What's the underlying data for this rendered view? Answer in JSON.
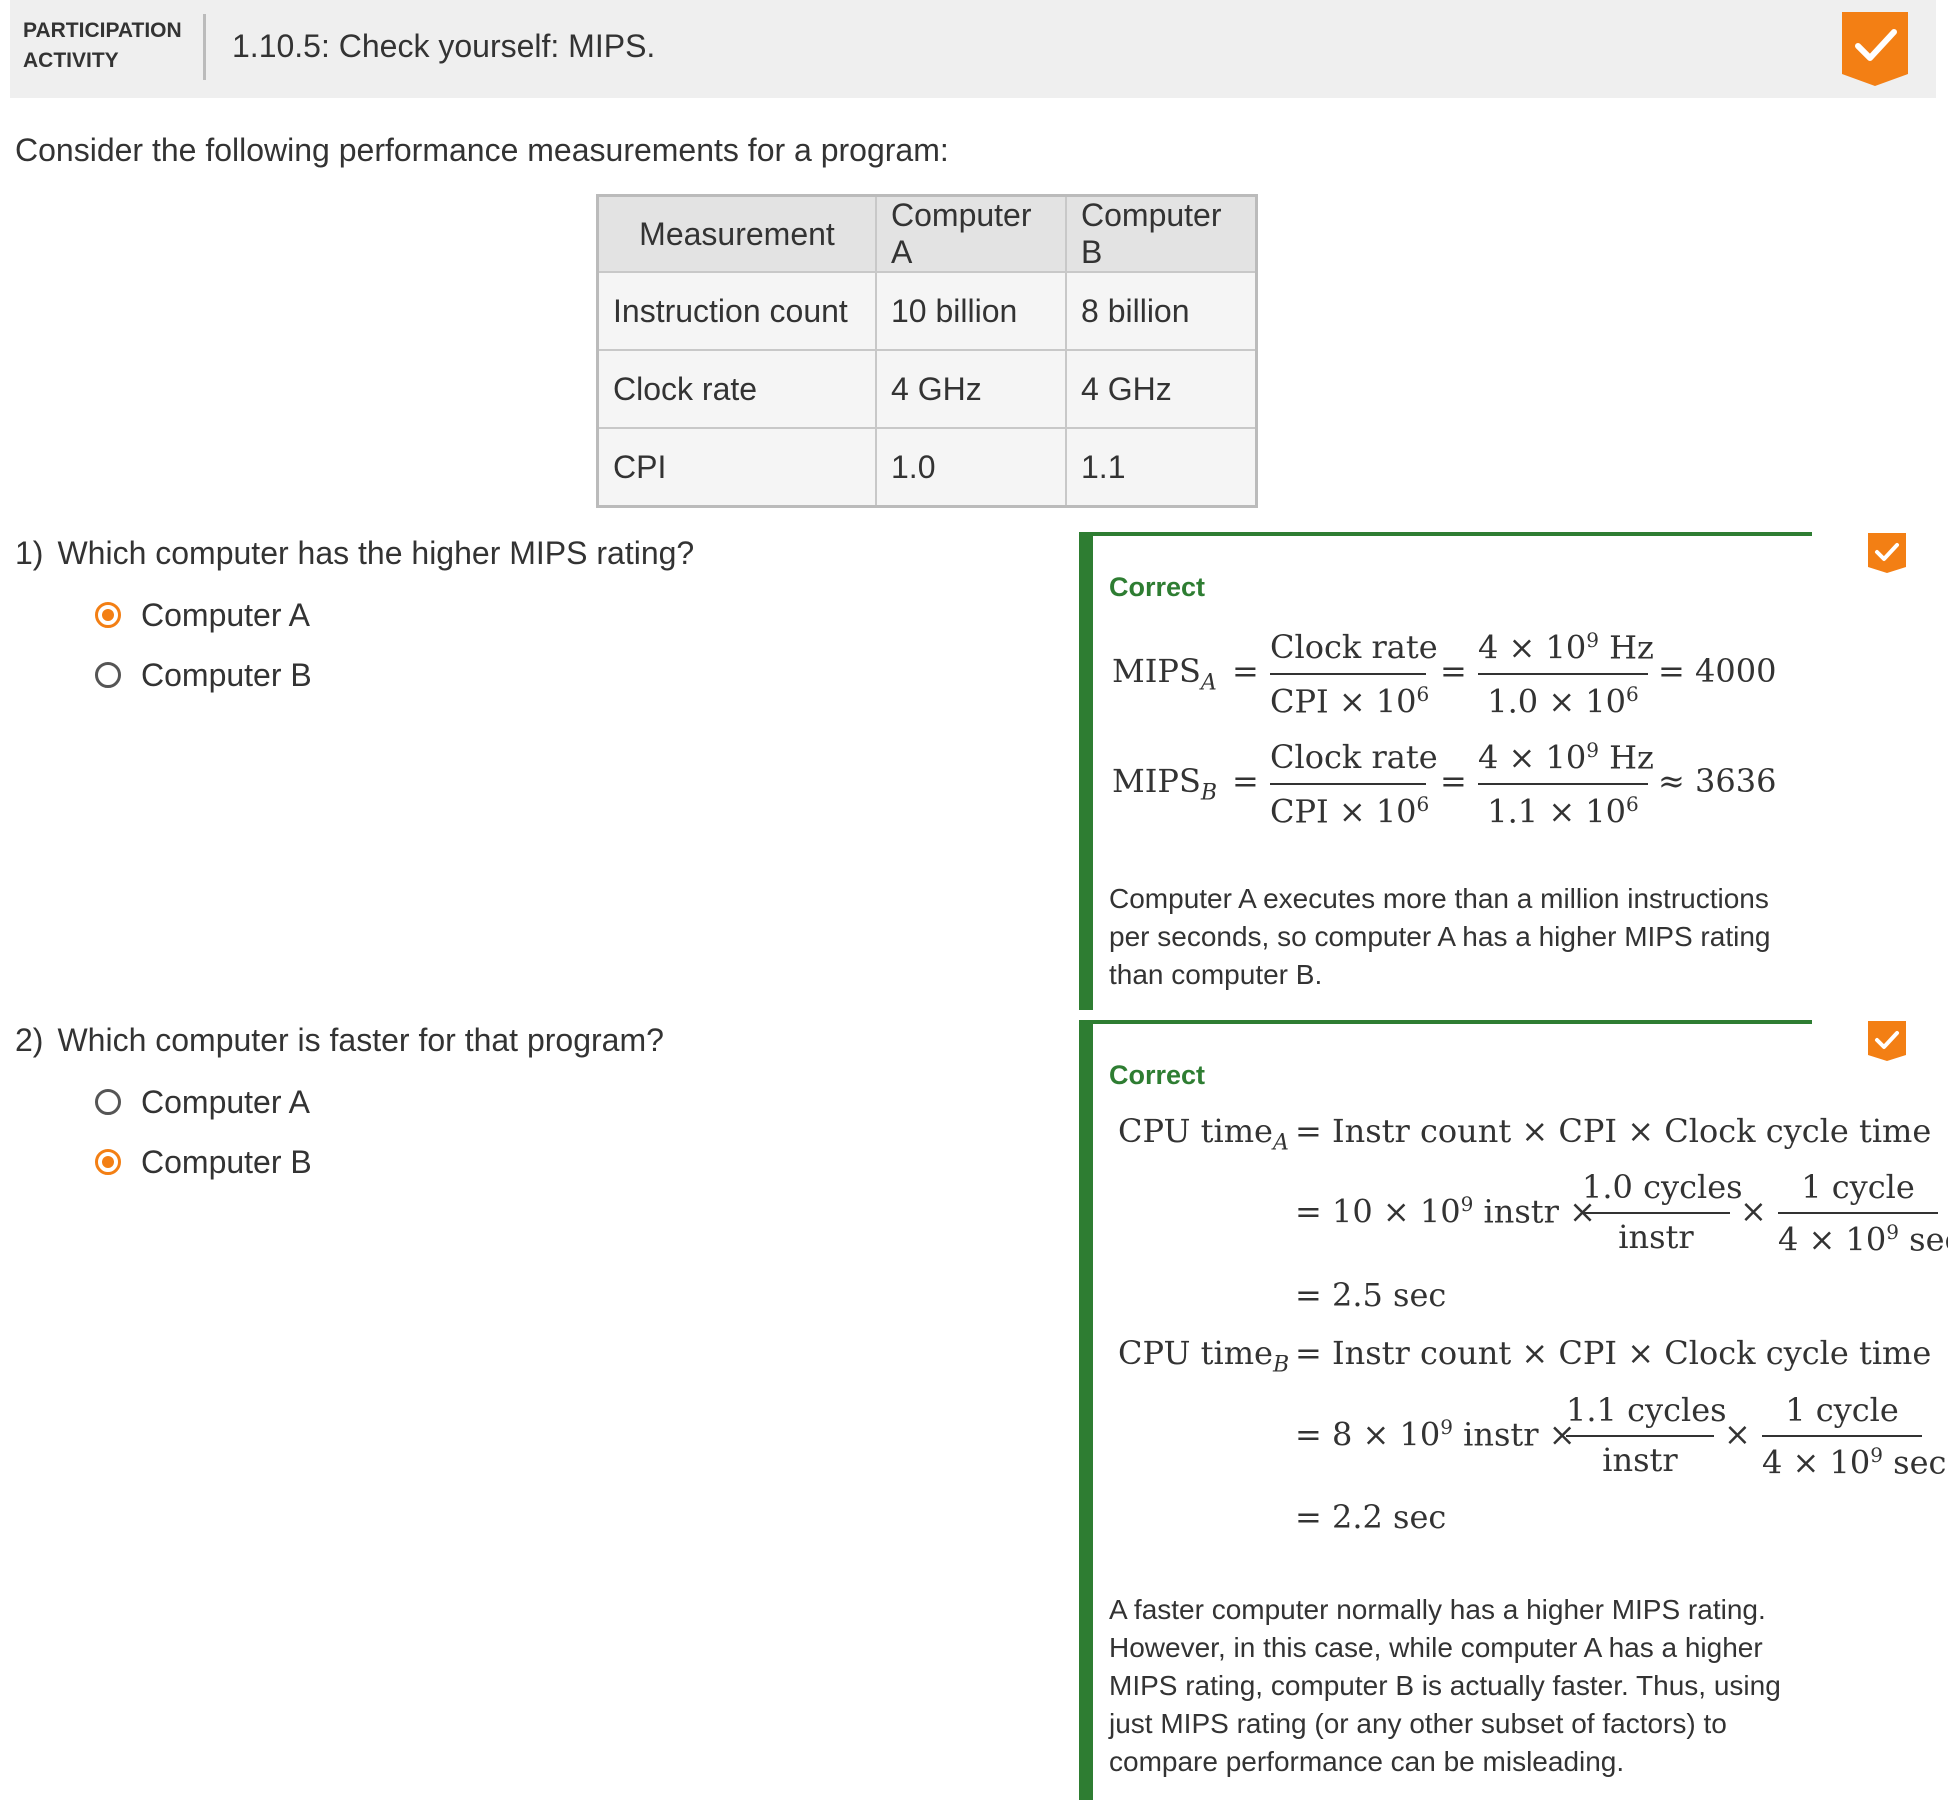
{
  "header": {
    "activity_label_line1": "PARTICIPATION",
    "activity_label_line2": "ACTIVITY",
    "title": "1.10.5: Check yourself: MIPS.",
    "status_icon": "checkmark-badge-icon",
    "accent_color": "#f37f14"
  },
  "intro": "Consider the following performance measurements for a program:",
  "table": {
    "headers": [
      "Measurement",
      "Computer A",
      "Computer B"
    ],
    "rows": [
      [
        "Instruction count",
        "10 billion",
        "8 billion"
      ],
      [
        "Clock rate",
        "4 GHz",
        "4 GHz"
      ],
      [
        "CPI",
        "1.0",
        "1.1"
      ]
    ]
  },
  "questions": [
    {
      "number": "1)",
      "text": "Which computer has the higher MIPS rating?",
      "options": [
        {
          "label": "Computer A",
          "selected": true
        },
        {
          "label": "Computer B",
          "selected": false
        }
      ],
      "feedback": {
        "status": "Correct",
        "status_color": "#2e7d32",
        "equations": [
          {
            "lhs": "MIPS",
            "sub": "A",
            "frac1_num": "Clock rate",
            "frac1_den": "CPI × 10",
            "frac1_den_exp": "6",
            "frac2_num": "4 × 10",
            "frac2_num_exp": "9",
            "frac2_num_unit": "Hz",
            "frac2_den": "1.0 × 10",
            "frac2_den_exp": "6",
            "rel": "=",
            "result": "4000"
          },
          {
            "lhs": "MIPS",
            "sub": "B",
            "frac1_num": "Clock rate",
            "frac1_den": "CPI × 10",
            "frac1_den_exp": "6",
            "frac2_num": "4 × 10",
            "frac2_num_exp": "9",
            "frac2_num_unit": "Hz",
            "frac2_den": "1.1 × 10",
            "frac2_den_exp": "6",
            "rel": "≈",
            "result": "3636"
          }
        ],
        "explanation_lines": [
          "Computer A executes more than a million instructions",
          "per seconds, so computer A has a higher MIPS rating",
          "than computer B."
        ]
      }
    },
    {
      "number": "2)",
      "text": "Which computer is faster for that program?",
      "options": [
        {
          "label": "Computer A",
          "selected": false
        },
        {
          "label": "Computer B",
          "selected": true
        }
      ],
      "feedback": {
        "status": "Correct",
        "status_color": "#2e7d32",
        "blocks": [
          {
            "lhs": "CPU time",
            "sub": "A",
            "formula": "= Instr count × CPI × Clock cycle time",
            "step_base": "= 10 × 10",
            "step_exp": "9",
            "step_tail": "instr ×",
            "cpi_num": "1.0 cycles",
            "cpi_den": "instr",
            "times": "×",
            "cyc_num": "1 cycle",
            "cyc_den": "4 × 10",
            "cyc_den_exp": "9",
            "cyc_den_unit": "sec",
            "result": "= 2.5 sec"
          },
          {
            "lhs": "CPU time",
            "sub": "B",
            "formula": "= Instr count × CPI × Clock cycle time",
            "step_base": "= 8 × 10",
            "step_exp": "9",
            "step_tail": "instr ×",
            "cpi_num": "1.1 cycles",
            "cpi_den": "instr",
            "times": "×",
            "cyc_num": "1 cycle",
            "cyc_den": "4 × 10",
            "cyc_den_exp": "9",
            "cyc_den_unit": "sec",
            "result": "= 2.2 sec"
          }
        ],
        "explanation_lines": [
          "A faster computer normally has a higher MIPS rating.",
          "However, in this case, while computer A has a higher",
          "MIPS rating, computer B is actually faster. Thus, using",
          "just MIPS rating (or any other subset of factors) to",
          "compare performance can be misleading."
        ]
      }
    }
  ]
}
